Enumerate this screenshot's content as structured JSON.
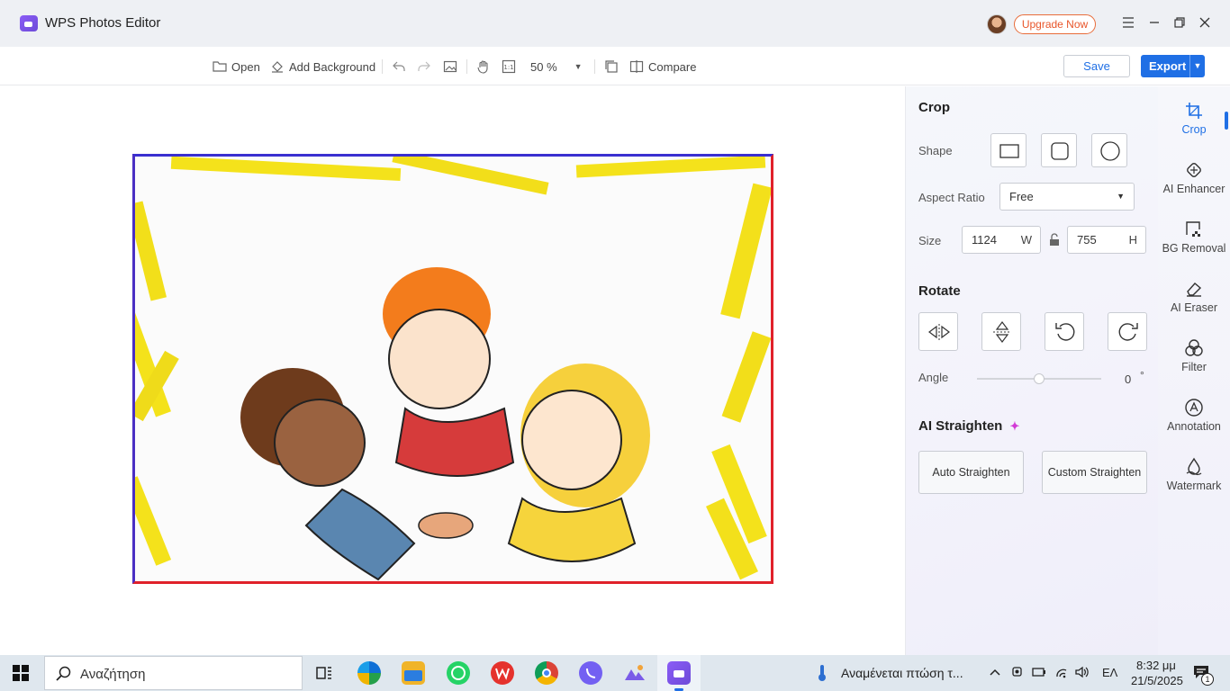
{
  "window": {
    "title": "WPS Photos Editor",
    "upgrade_label": "Upgrade Now"
  },
  "toolbar": {
    "open_label": "Open",
    "add_background_label": "Add Background",
    "zoom": "50 %",
    "compare_label": "Compare",
    "save_label": "Save",
    "export_label": "Export"
  },
  "panel": {
    "crop": {
      "title": "Crop",
      "shape_label": "Shape",
      "aspect_ratio_label": "Aspect Ratio",
      "aspect_ratio_value": "Free",
      "size_label": "Size",
      "width_value": "1124",
      "width_unit": "W",
      "height_value": "755",
      "height_unit": "H"
    },
    "rotate": {
      "title": "Rotate",
      "angle_label": "Angle",
      "angle_value": "0",
      "angle_unit": "°"
    },
    "straighten": {
      "title": "AI Straighten",
      "auto_label": "Auto Straighten",
      "custom_label": "Custom Straighten"
    }
  },
  "rail": {
    "items": [
      {
        "label": "Crop"
      },
      {
        "label": "AI Enhancer"
      },
      {
        "label": "BG Removal"
      },
      {
        "label": "AI Eraser"
      },
      {
        "label": "Filter"
      },
      {
        "label": "Annotation"
      },
      {
        "label": "Watermark"
      }
    ]
  },
  "taskbar": {
    "search_placeholder": "Αναζήτηση",
    "weather_text": "Αναμένεται πτώση τ...",
    "language": "ΕΛ",
    "time": "8:32 μμ",
    "date": "21/5/2025",
    "notification_count": "1"
  },
  "colors": {
    "accent": "#1f6fe5",
    "upgrade": "#e8552a",
    "brand": "#7c55e6"
  }
}
